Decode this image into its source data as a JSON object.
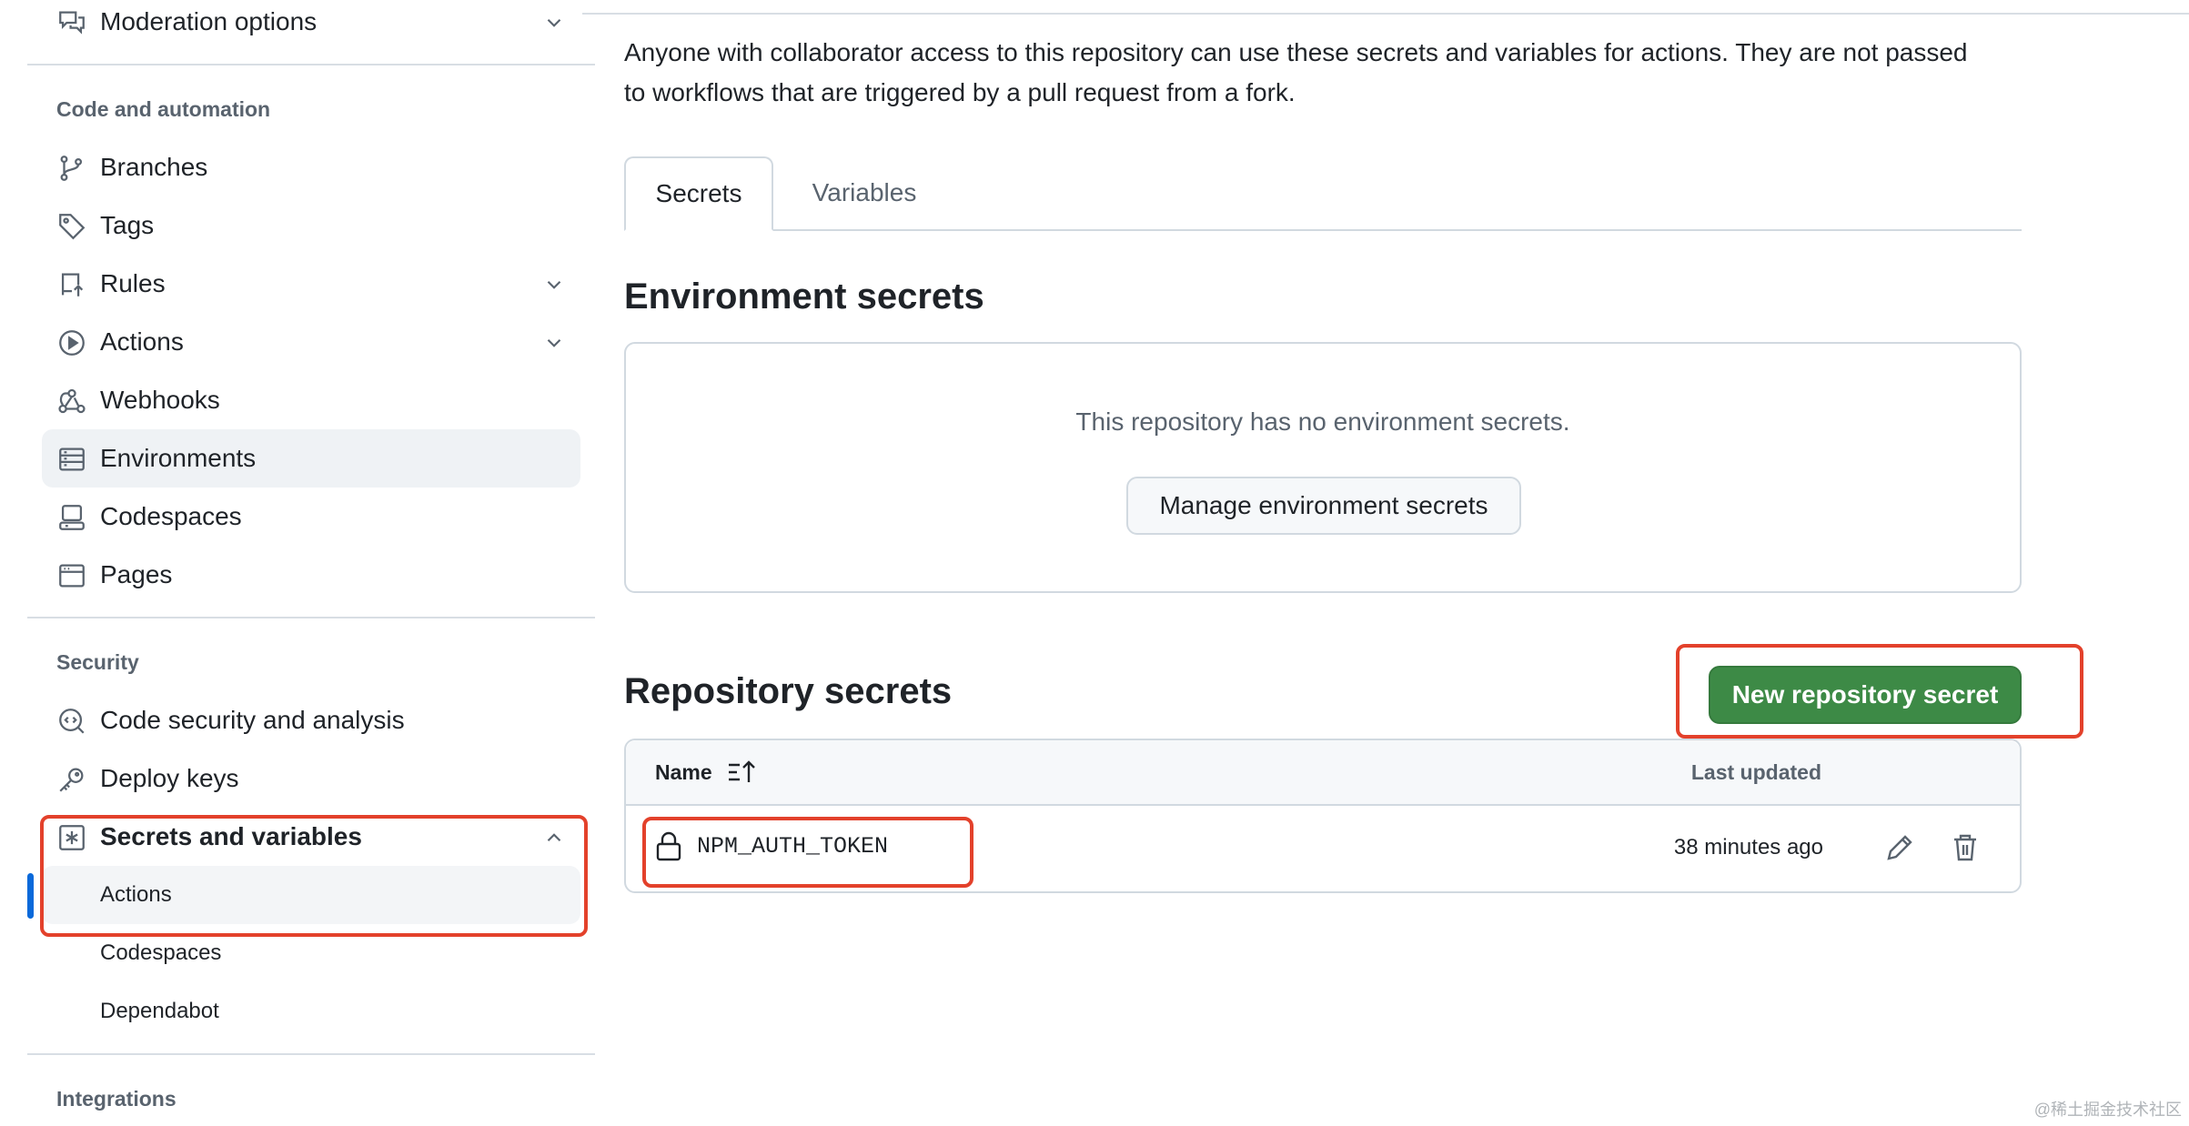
{
  "sidebar": {
    "top_item": {
      "label": "Moderation options",
      "icon": "comment-discussion-icon"
    },
    "code_automation_head": "Code and automation",
    "items": [
      {
        "label": "Branches",
        "icon": "git-branch-icon"
      },
      {
        "label": "Tags",
        "icon": "tag-icon"
      },
      {
        "label": "Rules",
        "icon": "repo-push-icon"
      },
      {
        "label": "Actions",
        "icon": "play-icon"
      },
      {
        "label": "Webhooks",
        "icon": "webhook-icon"
      },
      {
        "label": "Environments",
        "icon": "server-icon"
      },
      {
        "label": "Codespaces",
        "icon": "codespaces-icon"
      },
      {
        "label": "Pages",
        "icon": "browser-icon"
      }
    ],
    "security_head": "Security",
    "security_items": [
      {
        "label": "Code security and analysis",
        "icon": "codescan-icon"
      },
      {
        "label": "Deploy keys",
        "icon": "key-icon"
      },
      {
        "label": "Secrets and variables",
        "icon": "asterisk-icon"
      }
    ],
    "secrets_sub": [
      "Actions",
      "Codespaces",
      "Dependabot"
    ],
    "integrations_head": "Integrations"
  },
  "main": {
    "description": "Anyone with collaborator access to this repository can use these secrets and variables for actions. They are not passed to workflows that are triggered by a pull request from a fork.",
    "tabs": [
      {
        "label": "Secrets",
        "selected": true
      },
      {
        "label": "Variables",
        "selected": false
      }
    ],
    "env_secrets": {
      "title": "Environment secrets",
      "empty_text": "This repository has no environment secrets.",
      "manage_button": "Manage environment secrets"
    },
    "repo_secrets": {
      "title": "Repository secrets",
      "new_button": "New repository secret",
      "columns": {
        "name": "Name",
        "last_updated": "Last updated"
      },
      "rows": [
        {
          "name": "NPM_AUTH_TOKEN",
          "updated": "38 minutes ago"
        }
      ]
    }
  },
  "watermark": "@稀土掘金技术社区",
  "colors": {
    "accent_blue": "#0969da",
    "primary_green": "#3d8a46",
    "annotation_red": "#e3412b",
    "muted_text": "#59636e"
  }
}
